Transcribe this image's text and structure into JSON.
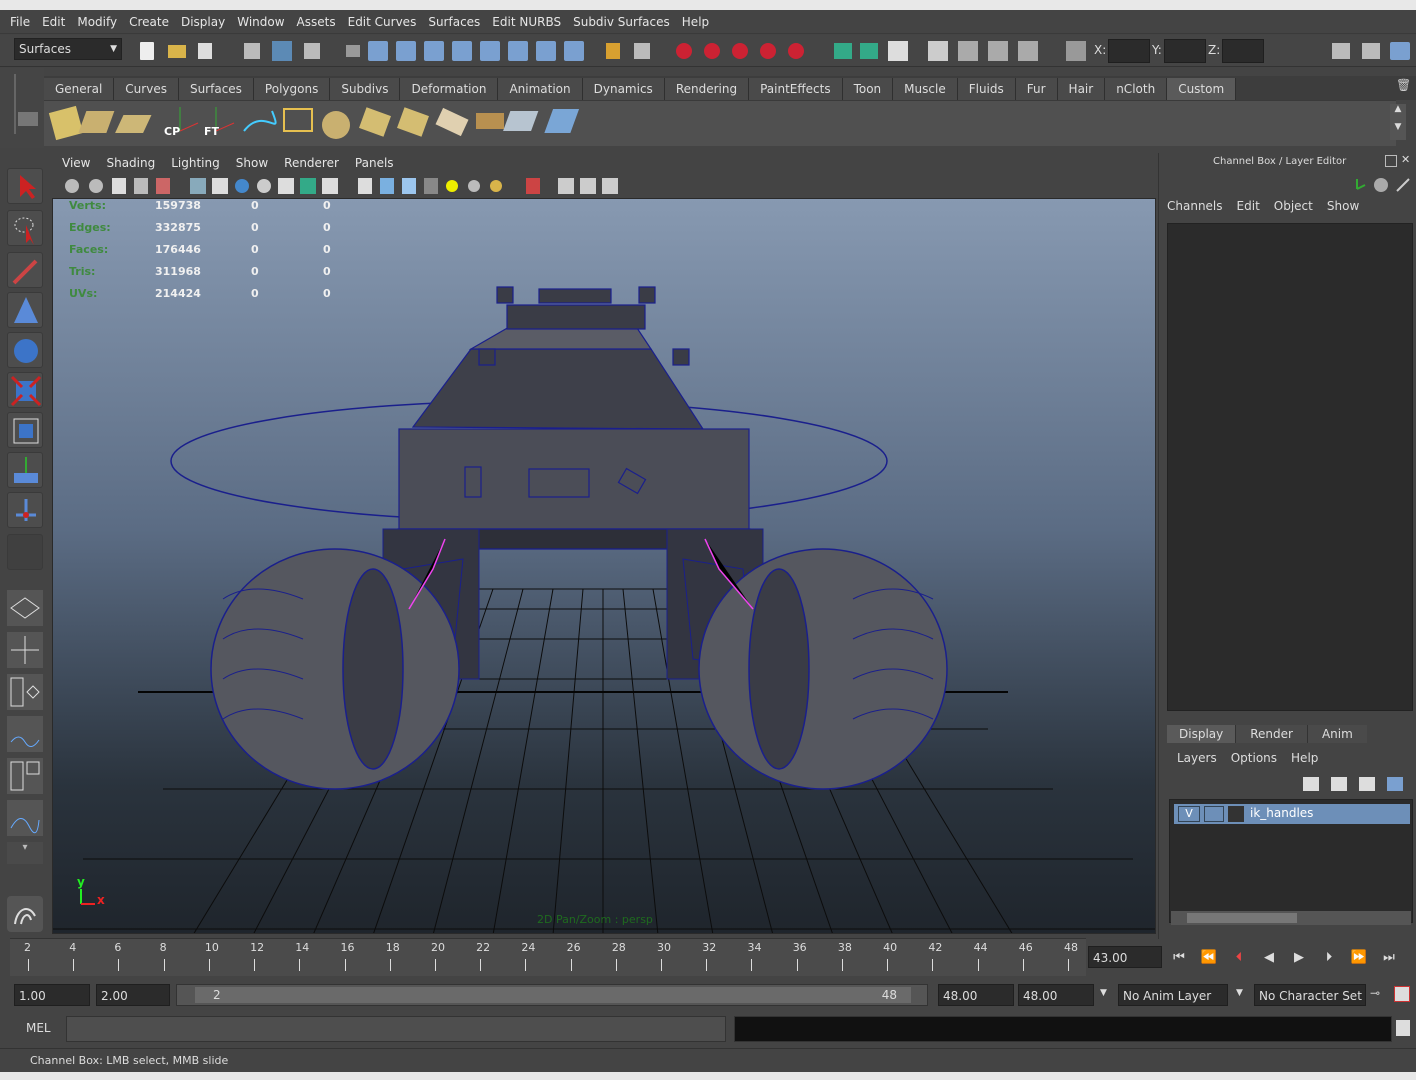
{
  "menubar": [
    "File",
    "Edit",
    "Modify",
    "Create",
    "Display",
    "Window",
    "Assets",
    "Edit Curves",
    "Surfaces",
    "Edit NURBS",
    "Subdiv Surfaces",
    "Help"
  ],
  "toolbar": {
    "menuset": "Surfaces",
    "x_label": "X:",
    "y_label": "Y:",
    "z_label": "Z:"
  },
  "shelf_tabs": [
    "General",
    "Curves",
    "Surfaces",
    "Polygons",
    "Subdivs",
    "Deformation",
    "Animation",
    "Dynamics",
    "Rendering",
    "PaintEffects",
    "Toon",
    "Muscle",
    "Fluids",
    "Fur",
    "Hair",
    "nCloth",
    "Custom"
  ],
  "shelf_icon_labels": {
    "cp": "CP",
    "ft": "FT"
  },
  "viewport_menu": [
    "View",
    "Shading",
    "Lighting",
    "Show",
    "Renderer",
    "Panels"
  ],
  "hud": [
    {
      "label": "Verts:",
      "value": "159738",
      "a": "0",
      "b": "0"
    },
    {
      "label": "Edges:",
      "value": "332875",
      "a": "0",
      "b": "0"
    },
    {
      "label": "Faces:",
      "value": "176446",
      "a": "0",
      "b": "0"
    },
    {
      "label": "Tris:",
      "value": "311968",
      "a": "0",
      "b": "0"
    },
    {
      "label": "UVs:",
      "value": "214424",
      "a": "0",
      "b": "0"
    }
  ],
  "viewport_label": "2D Pan/Zoom : persp",
  "axis": {
    "y": "y",
    "x": "x"
  },
  "channel_box": {
    "title": "Channel Box / Layer Editor",
    "menu": [
      "Channels",
      "Edit",
      "Object",
      "Show"
    ]
  },
  "layer_editor": {
    "tabs": [
      "Display",
      "Render",
      "Anim"
    ],
    "menu": [
      "Layers",
      "Options",
      "Help"
    ],
    "layer": {
      "visibility": "V",
      "name": "ik_handles"
    }
  },
  "timeline": {
    "ticks": [
      "2",
      "4",
      "6",
      "8",
      "10",
      "12",
      "14",
      "16",
      "18",
      "20",
      "22",
      "24",
      "26",
      "28",
      "30",
      "32",
      "34",
      "36",
      "38",
      "40",
      "42",
      "44",
      "46",
      "48"
    ],
    "current_frame": "43.00"
  },
  "range": {
    "start": "1.00",
    "start2": "2.00",
    "slider_start": "2",
    "slider_end": "48",
    "end": "48.00",
    "end2": "48.00",
    "anim_layer": "No Anim Layer",
    "char_set": "No Character Set"
  },
  "cmd": {
    "label": "MEL"
  },
  "help_line": "Channel Box: LMB select, MMB slide",
  "colors": {
    "accent": "#6d8fb8",
    "wire": "#1a1f8c",
    "hud_green": "#3f8a3f"
  }
}
